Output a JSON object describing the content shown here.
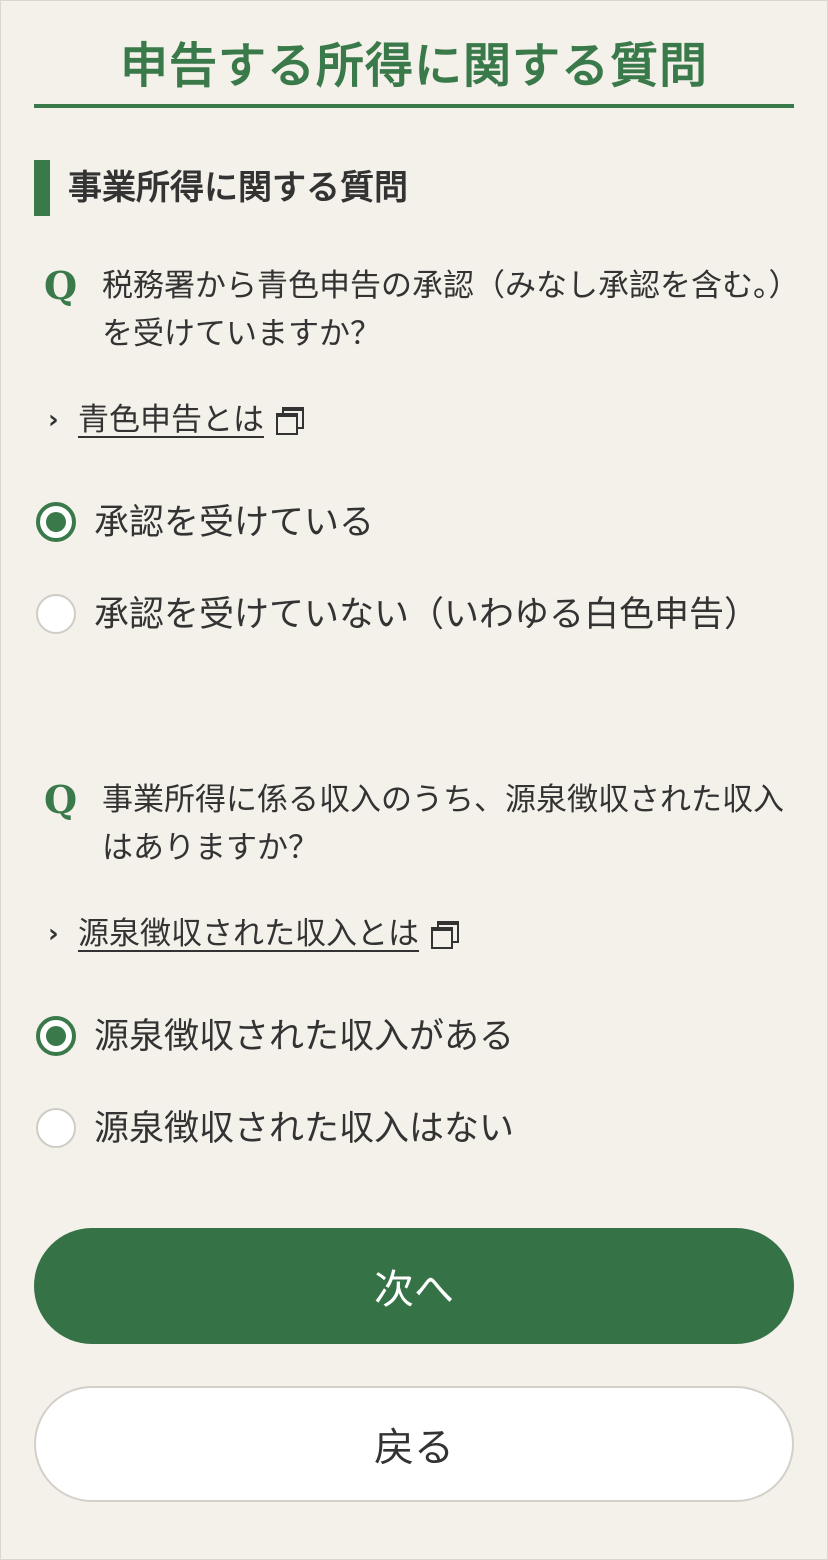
{
  "page": {
    "title": "申告する所得に関する質問"
  },
  "section": {
    "title": "事業所得に関する質問"
  },
  "q_mark": "Q",
  "questions": [
    {
      "text": "税務署から青色申告の承認（みなし承認を含む。）を受けていますか？",
      "help_link": "青色申告とは",
      "options": [
        {
          "label": "承認を受けている",
          "selected": true
        },
        {
          "label": "承認を受けていない（いわゆる白色申告）",
          "selected": false
        }
      ]
    },
    {
      "text": "事業所得に係る収入のうち、源泉徴収された収入はありますか？",
      "help_link": "源泉徴収された収入とは",
      "options": [
        {
          "label": "源泉徴収された収入がある",
          "selected": true
        },
        {
          "label": "源泉徴収された収入はない",
          "selected": false
        }
      ]
    }
  ],
  "buttons": {
    "next": "次へ",
    "back": "戻る"
  },
  "icons": {
    "link_chevron": "chevron-right-icon",
    "external": "external-window-icon",
    "radio_on": "radio-selected-icon",
    "radio_off": "radio-unselected-icon"
  },
  "colors": {
    "accent": "#3a7a4a",
    "button_primary": "#357347",
    "background": "#f4f1ea"
  }
}
